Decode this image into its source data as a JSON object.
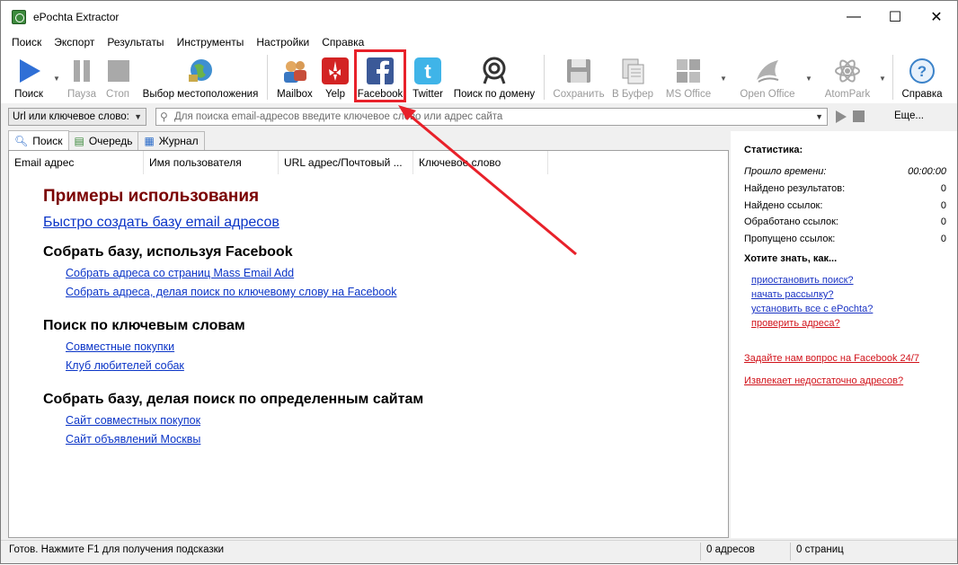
{
  "window": {
    "title": "ePochta Extractor"
  },
  "window_controls": {
    "minimize": "—",
    "maximize": "☐",
    "close": "✕"
  },
  "menu": [
    "Поиск",
    "Экспорт",
    "Результаты",
    "Инструменты",
    "Настройки",
    "Справка"
  ],
  "toolbar": {
    "search": "Поиск",
    "pause": "Пауза",
    "stop": "Стоп",
    "location": "Выбор местоположения",
    "mailbox": "Mailbox",
    "yelp": "Yelp",
    "facebook": "Facebook",
    "twitter": "Twitter",
    "domain_search": "Поиск по домену",
    "save": "Сохранить",
    "clipboard": "В Буфер",
    "ms_office": "MS Office",
    "open_office": "Open Office",
    "atompark": "AtomPark",
    "help": "Справка"
  },
  "search": {
    "type_selected": "Url или ключевое слово:",
    "placeholder": "Для поиска email-адресов введите ключевое слово или адрес сайта",
    "more": "Еще..."
  },
  "tabs": [
    "Поиск",
    "Очередь",
    "Журнал"
  ],
  "columns": [
    "Email адрес",
    "Имя пользователя",
    "URL адрес/Почтовый ...",
    "Ключевое слово"
  ],
  "content": {
    "heading": "Примеры использования",
    "quick_link": "Быстро создать базу email адресов",
    "sections": [
      {
        "title": "Собрать базу, используя Facebook",
        "links": [
          "Собрать адреса со страниц Mass Email Add",
          "Собрать адреса, делая поиск по ключевому слову на Facebook"
        ]
      },
      {
        "title": "Поиск по ключевым словам",
        "links": [
          "Совместные покупки",
          "Клуб любителей собак"
        ]
      },
      {
        "title": "Собрать базу, делая поиск по определенным сайтам",
        "links": [
          "Сайт совместных покупок",
          "Сайт объявлений Москвы"
        ]
      }
    ]
  },
  "stats": {
    "title": "Статистика:",
    "rows": [
      {
        "label": "Прошло времени:",
        "value": "00:00:00"
      },
      {
        "label": "Найдено результатов:",
        "value": "0"
      },
      {
        "label": "Найдено ссылок:",
        "value": "0"
      },
      {
        "label": "Обработано ссылок:",
        "value": "0"
      },
      {
        "label": "Пропущено ссылок:",
        "value": "0"
      }
    ]
  },
  "know": {
    "title": "Хотите знать, как...",
    "links": [
      "приостановить поиск?",
      "начать рассылку?",
      "установить все с ePochta?",
      "проверить адреса?"
    ],
    "extra_links": [
      "Задайте нам вопрос на Facebook 24/7",
      "Извлекает недостаточно адресов?"
    ]
  },
  "status": {
    "message": "Готов. Нажмите F1 для получения подсказки",
    "addresses": "0 адресов",
    "pages": "0 страниц"
  },
  "colors": {
    "accent_red": "#e8212a",
    "link_blue": "#0b35c7",
    "heading_dark_red": "#7a0000"
  }
}
